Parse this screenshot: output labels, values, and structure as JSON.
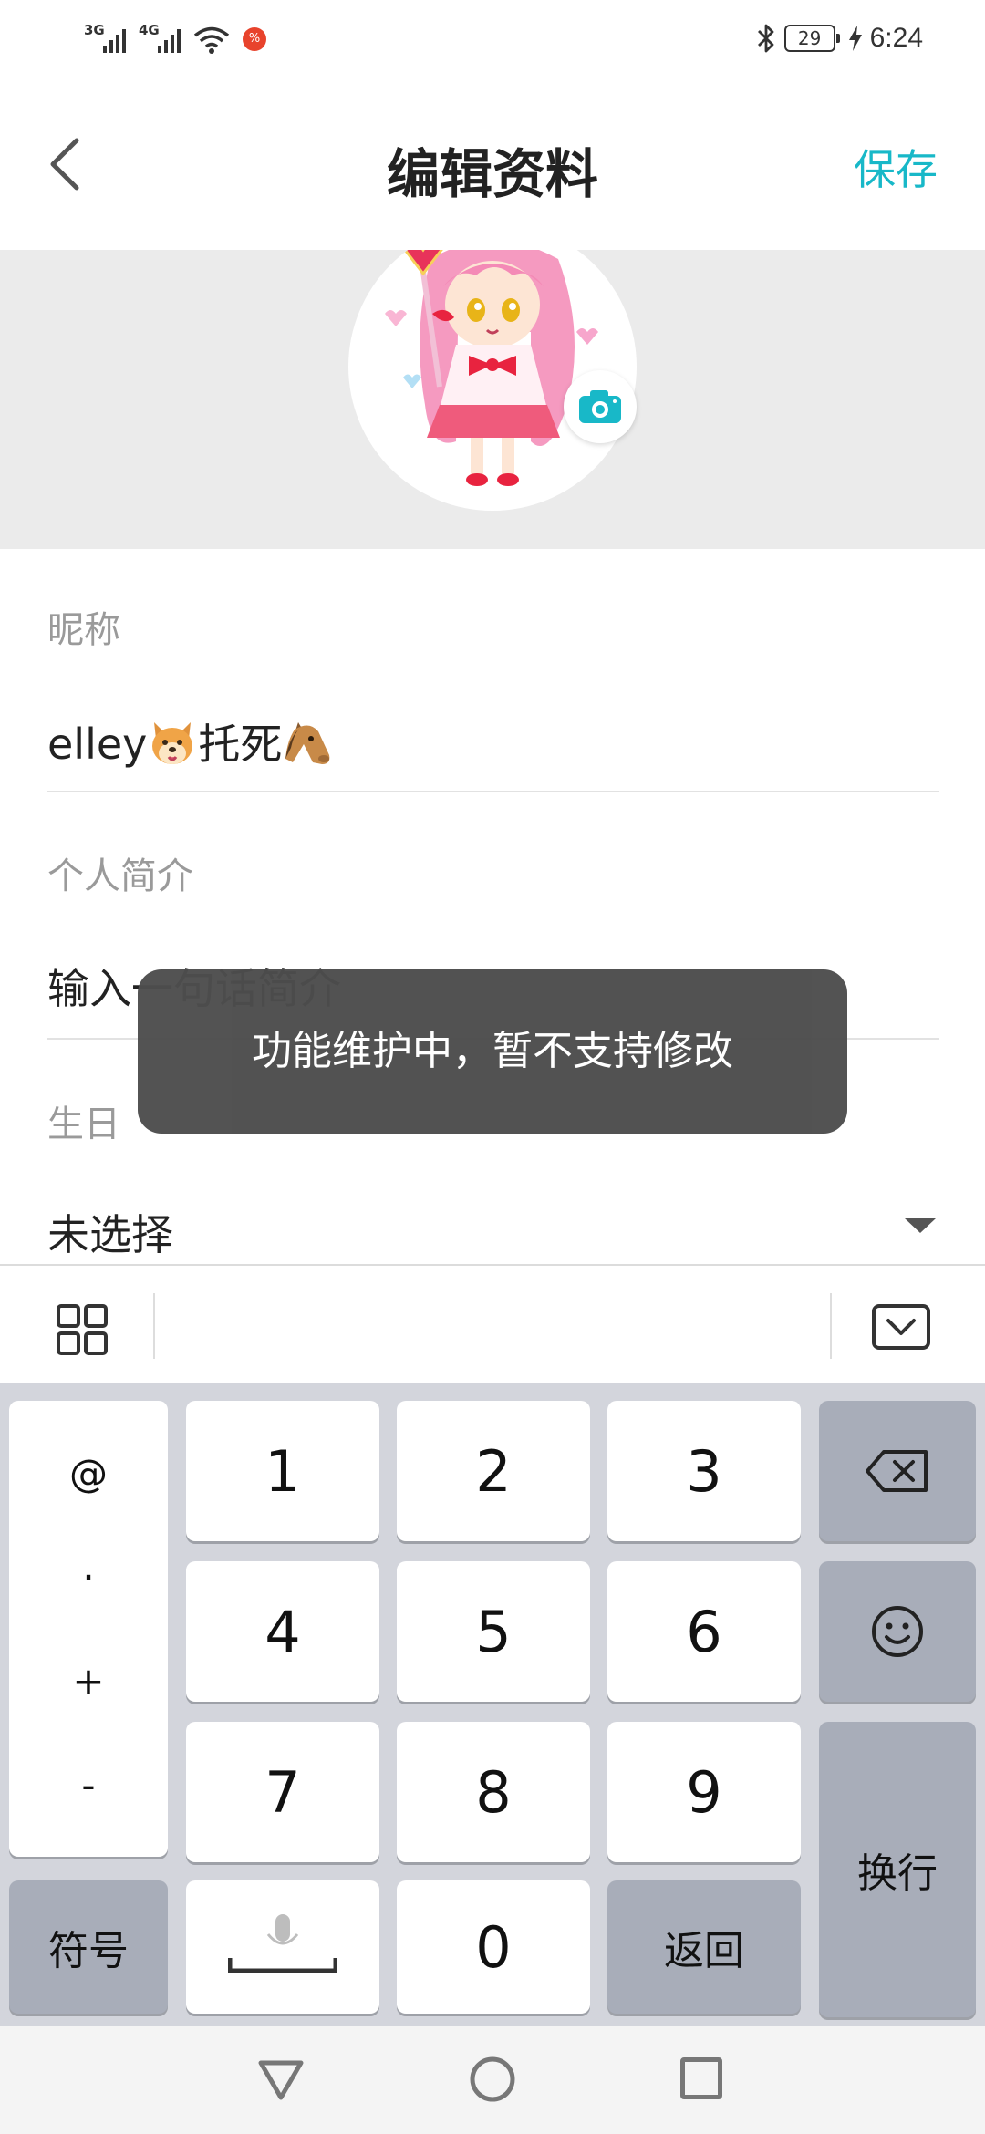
{
  "status_bar": {
    "net1": "3G",
    "net2": "4G",
    "notif_badge": "%",
    "battery": "29",
    "time": "6:24"
  },
  "header": {
    "title": "编辑资料",
    "save_label": "保存"
  },
  "form": {
    "nickname_label": "昵称",
    "nickname_text1": "elley",
    "nickname_text2": "托死",
    "bio_label": "个人简介",
    "bio_placeholder": "输入一句话简介",
    "birthday_label": "生日",
    "birthday_value": "未选择"
  },
  "toast": {
    "message": "功能维护中，暂不支持修改"
  },
  "keyboard": {
    "sym_keys": [
      "@",
      "·",
      "+",
      "-"
    ],
    "digits": [
      "1",
      "2",
      "3",
      "4",
      "5",
      "6",
      "7",
      "8",
      "9",
      "0"
    ],
    "symbols_label": "符号",
    "return_label": "返回",
    "enter_label": "换行"
  },
  "icons": {
    "back": "chevron-left-icon",
    "camera": "camera-icon",
    "grid": "grid-icon",
    "collapse": "keyboard-collapse-icon",
    "backspace": "backspace-icon",
    "emoji": "smiley-icon",
    "mic": "microphone-icon"
  },
  "colors": {
    "accent": "#18b8c8",
    "toast_bg": "#4d4d4d",
    "keyboard_bg": "#d3d5dc"
  }
}
